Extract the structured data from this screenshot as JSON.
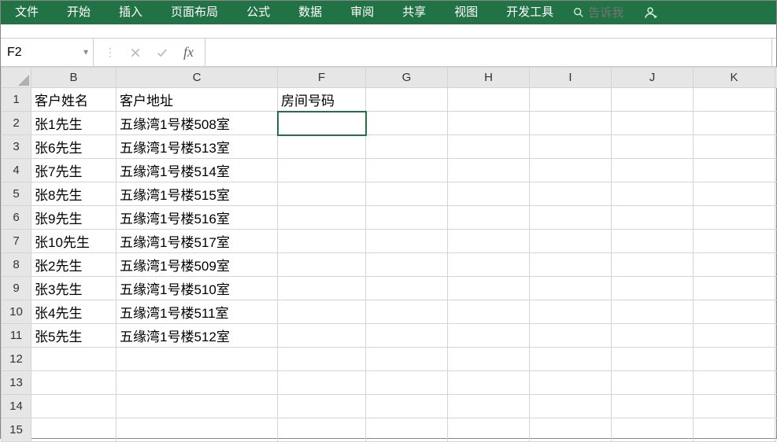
{
  "menu": {
    "items": [
      "文件",
      "开始",
      "插入",
      "页面布局",
      "公式",
      "数据",
      "审阅",
      "共享",
      "视图",
      "开发工具"
    ],
    "search_placeholder": "告诉我"
  },
  "namebox": {
    "value": "F2"
  },
  "formula": {
    "value": ""
  },
  "columns": [
    "B",
    "C",
    "F",
    "G",
    "H",
    "I",
    "J",
    "K"
  ],
  "active": {
    "col": "F",
    "row": 2
  },
  "rows": [
    {
      "n": 1,
      "B": "客户姓名",
      "C": "客户地址",
      "F": "房间号码"
    },
    {
      "n": 2,
      "B": "张1先生",
      "C": "五缘湾1号楼508室",
      "F": ""
    },
    {
      "n": 3,
      "B": "张6先生",
      "C": "五缘湾1号楼513室",
      "F": ""
    },
    {
      "n": 4,
      "B": "张7先生",
      "C": "五缘湾1号楼514室",
      "F": ""
    },
    {
      "n": 5,
      "B": "张8先生",
      "C": "五缘湾1号楼515室",
      "F": ""
    },
    {
      "n": 6,
      "B": "张9先生",
      "C": "五缘湾1号楼516室",
      "F": ""
    },
    {
      "n": 7,
      "B": "张10先生",
      "C": "五缘湾1号楼517室",
      "F": ""
    },
    {
      "n": 8,
      "B": "张2先生",
      "C": "五缘湾1号楼509室",
      "F": ""
    },
    {
      "n": 9,
      "B": "张3先生",
      "C": "五缘湾1号楼510室",
      "F": ""
    },
    {
      "n": 10,
      "B": "张4先生",
      "C": "五缘湾1号楼511室",
      "F": ""
    },
    {
      "n": 11,
      "B": "张5先生",
      "C": "五缘湾1号楼512室",
      "F": ""
    },
    {
      "n": 12,
      "B": "",
      "C": "",
      "F": ""
    },
    {
      "n": 13,
      "B": "",
      "C": "",
      "F": ""
    },
    {
      "n": 14,
      "B": "",
      "C": "",
      "F": ""
    },
    {
      "n": 15,
      "B": "",
      "C": "",
      "F": ""
    }
  ]
}
